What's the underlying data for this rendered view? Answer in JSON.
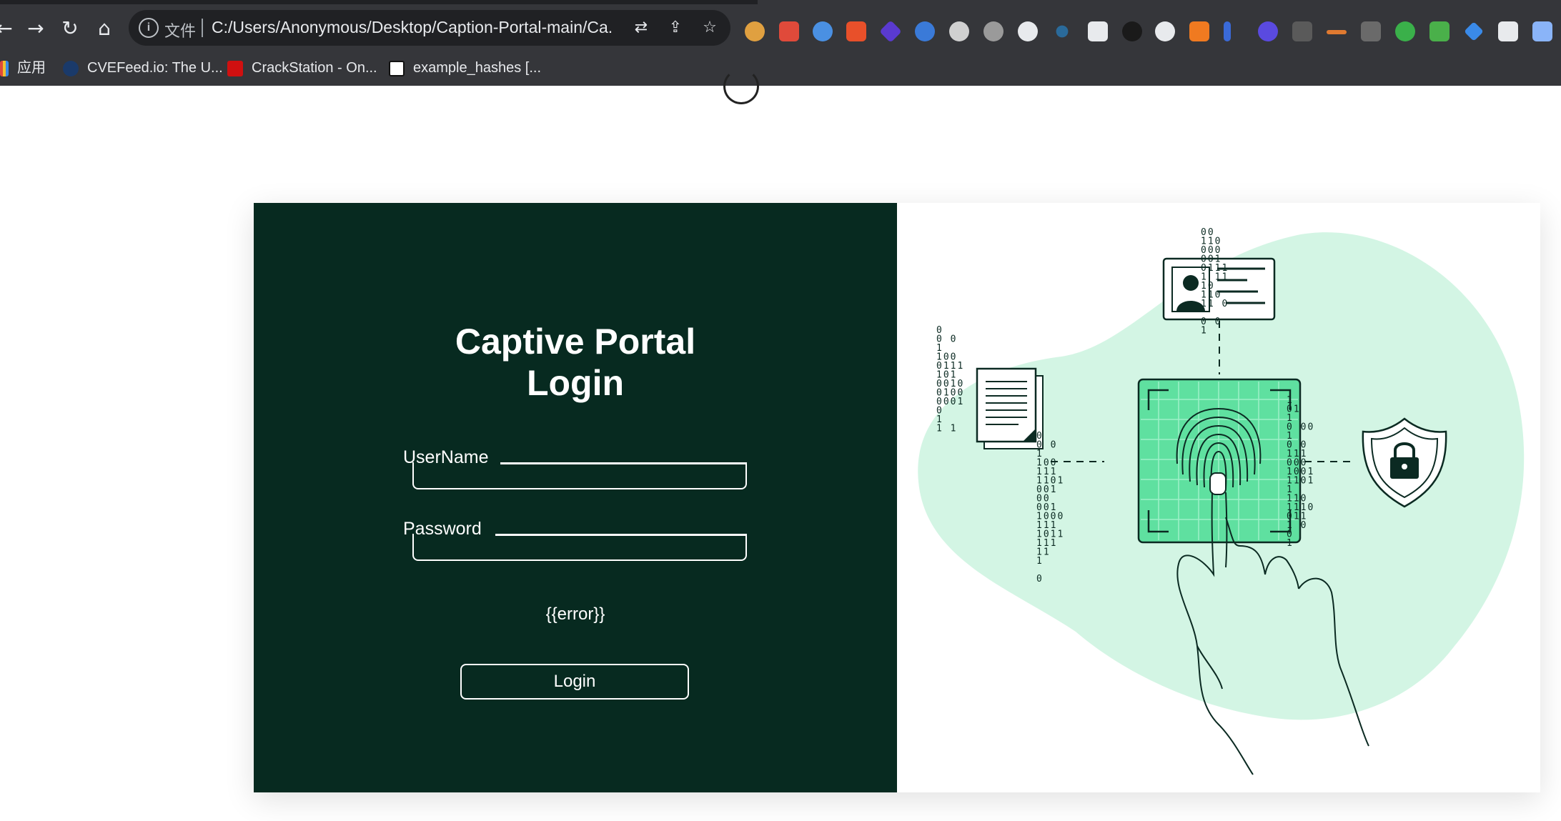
{
  "browser": {
    "url": "C:/Users/Anonymous/Desktop/Caption-Portal-main/Ca...",
    "file_label": "文件",
    "bookmarks": [
      {
        "label": "应用"
      },
      {
        "label": "CVEFeed.io: The U..."
      },
      {
        "label": "CrackStation - On..."
      },
      {
        "label": "example_hashes [..."
      }
    ]
  },
  "login": {
    "title_line1": "Captive Portal",
    "title_line2": "Login",
    "username_label": "UserName",
    "password_label": "Password",
    "error_text": "{{error}}",
    "login_button": "Login"
  },
  "illustration": {
    "binary_left": [
      "0",
      "0 0",
      "1",
      "100",
      "0111",
      "101",
      "0010",
      "0100",
      "0001",
      "0",
      "1",
      "1  1"
    ],
    "binary_top_right": [
      "00",
      "110",
      "000",
      "001",
      "0111",
      "1  11",
      "10",
      "110",
      "11  0",
      "",
      "0   0",
      "1"
    ],
    "binary_mid": [
      "0",
      "0  0",
      "1",
      "100",
      "111",
      "1101",
      "001",
      "00",
      "001",
      "1000",
      "111",
      "1011",
      "111",
      "11",
      "1",
      "",
      "0"
    ],
    "binary_far_right": [
      "1",
      "01",
      "1",
      "0  00",
      "1",
      "0  0",
      "111",
      "000",
      "1001",
      "1101",
      "1",
      "110",
      "1110",
      "011",
      "1  0",
      "0",
      "1"
    ]
  },
  "colors": {
    "panel_bg": "#072a20",
    "accent_mint": "#d3f5e4",
    "accent_green": "#5fe0a0"
  }
}
